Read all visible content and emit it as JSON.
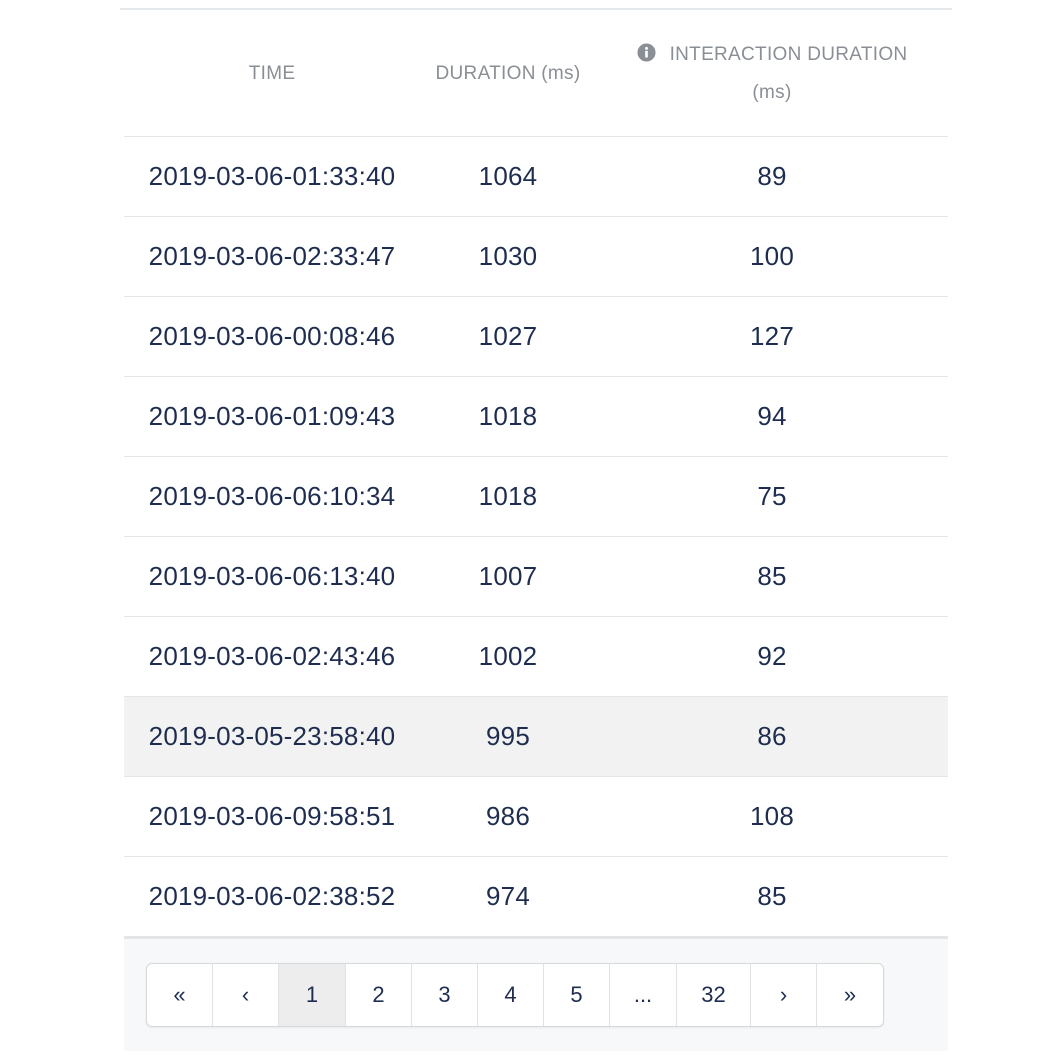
{
  "table": {
    "headers": {
      "time": "TIME",
      "duration": "DURATION (ms)",
      "interaction_line1": "INTERACTION DURATION",
      "interaction_line2": "(ms)"
    },
    "header_icon": "info-circle-icon",
    "rows": [
      {
        "time": "2019-03-06-01:33:40",
        "duration": "1064",
        "interaction": "89"
      },
      {
        "time": "2019-03-06-02:33:47",
        "duration": "1030",
        "interaction": "100"
      },
      {
        "time": "2019-03-06-00:08:46",
        "duration": "1027",
        "interaction": "127"
      },
      {
        "time": "2019-03-06-01:09:43",
        "duration": "1018",
        "interaction": "94"
      },
      {
        "time": "2019-03-06-06:10:34",
        "duration": "1018",
        "interaction": "75"
      },
      {
        "time": "2019-03-06-06:13:40",
        "duration": "1007",
        "interaction": "85"
      },
      {
        "time": "2019-03-06-02:43:46",
        "duration": "1002",
        "interaction": "92"
      },
      {
        "time": "2019-03-05-23:58:40",
        "duration": "995",
        "interaction": "86"
      },
      {
        "time": "2019-03-06-09:58:51",
        "duration": "986",
        "interaction": "108"
      },
      {
        "time": "2019-03-06-02:38:52",
        "duration": "974",
        "interaction": "85"
      }
    ],
    "highlighted_row_index": 7
  },
  "pagination": {
    "first": "«",
    "prev": "‹",
    "pages": [
      "1",
      "2",
      "3",
      "4",
      "5"
    ],
    "ellipsis": "...",
    "last_page": "32",
    "next": "›",
    "last": "»",
    "current": "1"
  },
  "colors": {
    "text": "#1e2d4f",
    "header_text": "#8a8f96",
    "highlight_row": "#f2f2f2",
    "active_page": "#ededed"
  }
}
